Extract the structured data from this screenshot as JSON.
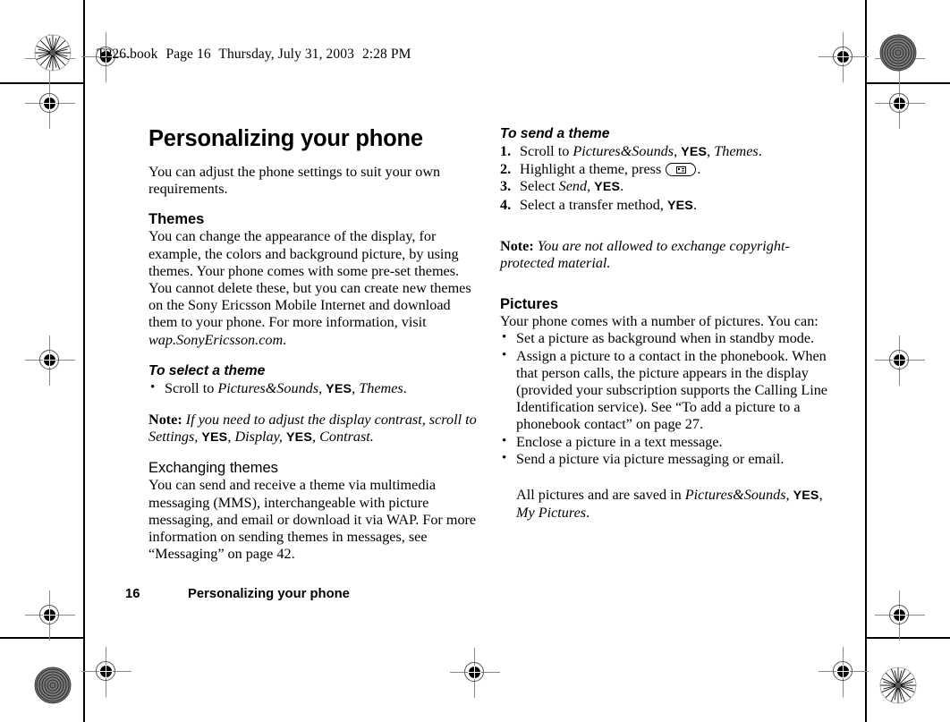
{
  "sheet": {
    "header_file": "T226.book",
    "header_page": "Page 16",
    "header_day": "Thursday, July 31, 2003",
    "header_time": "2:28 PM"
  },
  "footer": {
    "page_number": "16",
    "running_title": "Personalizing your phone"
  },
  "left_column": {
    "title": "Personalizing your phone",
    "intro": "You can adjust the phone settings to suit your own requirements.",
    "themes_heading": "Themes",
    "themes_body_1": "You can change the appearance of the display, for example, the colors and background picture, by using themes. Your phone comes with some pre-set themes. You cannot delete these, but you can create new themes on the Sony Ericsson Mobile Internet and download them to your phone. For more information, visit ",
    "themes_body_url": "wap.SonyEricsson.com",
    "themes_body_end": ".",
    "select_theme_heading": "To select a theme",
    "select_theme_bullet": {
      "pre": "Scroll to ",
      "menu1": "Pictures&Sounds",
      "sep1": ", ",
      "key1": "YES",
      "sep2": ", ",
      "menu2": "Themes",
      "end": "."
    },
    "note_label": "Note:",
    "note_text_1": " If you need to adjust the display contrast, scroll to Settings, ",
    "note_key1": "YES",
    "note_text_2": ", Display, ",
    "note_key2": "YES",
    "note_text_3": ", Contrast."
  },
  "left_column_2": {
    "exchanging_heading": "Exchanging themes",
    "exchanging_body": "You can send and receive a theme via multimedia messaging (MMS), interchangeable with picture messaging, and email or download it via WAP. For more information on sending themes in messages, see “Messaging” on page 42."
  },
  "right_column": {
    "send_theme_heading": "To send a theme",
    "steps": [
      {
        "pre": "Scroll to ",
        "menu1": "Pictures&Sounds",
        "sep1": ", ",
        "key1": "YES",
        "sep2": ", ",
        "menu2": "Themes",
        "end": "."
      },
      {
        "pre": "Highlight a theme, press ",
        "icon": "phone-menu-key-icon",
        "end": "."
      },
      {
        "pre": "Select ",
        "menu1": "Send",
        "sep1": ", ",
        "key1": "YES",
        "end": "."
      },
      {
        "pre": "Select a transfer method, ",
        "key1": "YES",
        "end": "."
      }
    ],
    "note_label": "Note:",
    "note_text": " You are not allowed to exchange copyright-protected material.",
    "pictures_heading": "Pictures",
    "pictures_intro": "Your phone comes with a number of pictures. You can:",
    "pictures_bullets": [
      "Set a picture as background when in standby mode.",
      "Assign a picture to a contact in the phonebook. When that person calls, the picture appears in the display (provided your subscription supports the Calling Line Identification service). See “To add a picture to a phonebook contact” on page 27.",
      "Enclose a picture in a text message.",
      "Send a picture via picture messaging or email."
    ],
    "closing": {
      "pre": "All pictures and are saved in ",
      "menu1": "Pictures&Sounds",
      "sep1": ", ",
      "key1": "YES",
      "sep2": ", ",
      "menu2": "My Pictures",
      "end": "."
    }
  },
  "colors": {
    "ink": "#000000",
    "paper": "#ffffff",
    "reg_line": "#888888"
  }
}
